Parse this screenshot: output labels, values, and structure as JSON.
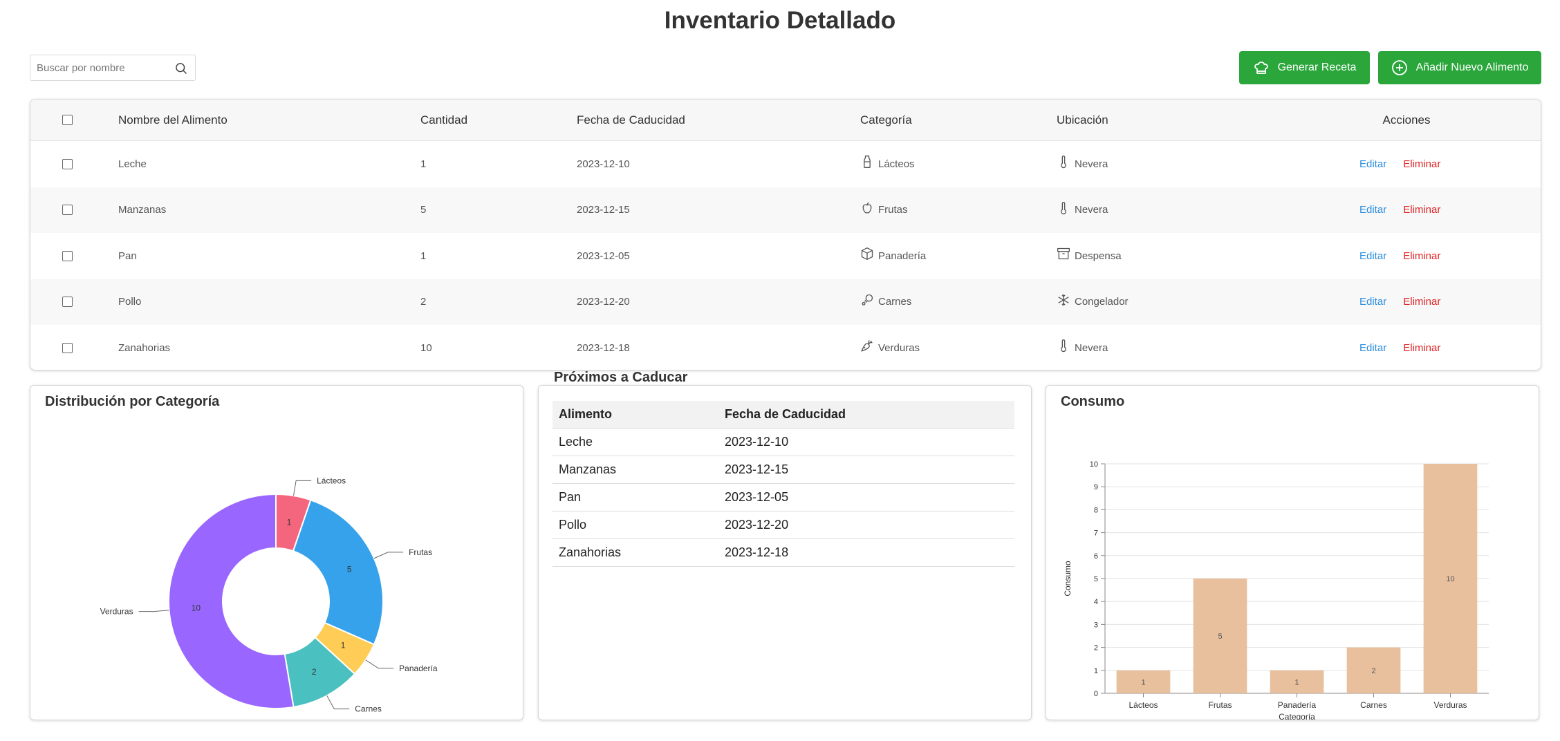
{
  "page": {
    "title": "Inventario Detallado"
  },
  "search": {
    "placeholder": "Buscar por nombre",
    "icon": "search-icon"
  },
  "toolbar": {
    "recipe_label": "Generar Receta",
    "recipe_icon": "chef-hat-icon",
    "add_label": "Añadir Nuevo Alimento",
    "add_icon": "plus-circle-icon"
  },
  "accent_color": "#2aa63b",
  "table": {
    "headers": {
      "name": "Nombre del Alimento",
      "qty": "Cantidad",
      "date": "Fecha de Caducidad",
      "category": "Categoría",
      "location": "Ubicación",
      "actions": "Acciones"
    },
    "rows": [
      {
        "name": "Leche",
        "qty": "1",
        "date": "2023-12-10",
        "category": "Lácteos",
        "category_icon": "milk-bottle-icon",
        "location": "Nevera",
        "location_icon": "thermometer-icon",
        "edit": "Editar",
        "delete": "Eliminar"
      },
      {
        "name": "Manzanas",
        "qty": "5",
        "date": "2023-12-15",
        "category": "Frutas",
        "category_icon": "apple-icon",
        "location": "Nevera",
        "location_icon": "thermometer-icon",
        "edit": "Editar",
        "delete": "Eliminar"
      },
      {
        "name": "Pan",
        "qty": "1",
        "date": "2023-12-05",
        "category": "Panadería",
        "category_icon": "box-icon",
        "location": "Despensa",
        "location_icon": "archive-icon",
        "edit": "Editar",
        "delete": "Eliminar"
      },
      {
        "name": "Pollo",
        "qty": "2",
        "date": "2023-12-20",
        "category": "Carnes",
        "category_icon": "drumstick-icon",
        "location": "Congelador",
        "location_icon": "snowflake-icon",
        "edit": "Editar",
        "delete": "Eliminar"
      },
      {
        "name": "Zanahorias",
        "qty": "10",
        "date": "2023-12-18",
        "category": "Verduras",
        "category_icon": "carrot-icon",
        "location": "Nevera",
        "location_icon": "thermometer-icon",
        "edit": "Editar",
        "delete": "Eliminar"
      }
    ],
    "edit_color": "#2b8ee0",
    "delete_color": "#e02424"
  },
  "category_panel": {
    "title": "Distribución por Categoría"
  },
  "expiring_panel": {
    "title": "Próximos a Caducar",
    "headers": {
      "food": "Alimento",
      "date": "Fecha de Caducidad"
    },
    "rows": [
      {
        "food": "Leche",
        "date": "2023-12-10"
      },
      {
        "food": "Manzanas",
        "date": "2023-12-15"
      },
      {
        "food": "Pan",
        "date": "2023-12-05"
      },
      {
        "food": "Pollo",
        "date": "2023-12-20"
      },
      {
        "food": "Zanahorias",
        "date": "2023-12-18"
      }
    ]
  },
  "consumption_panel": {
    "title": "Consumo"
  },
  "chart_data": [
    {
      "type": "pie",
      "title": "Distribución por Categoría",
      "donut": true,
      "categories": [
        "Lácteos",
        "Frutas",
        "Panadería",
        "Carnes",
        "Verduras"
      ],
      "values": [
        1,
        5,
        1,
        2,
        10
      ],
      "colors": [
        "#f4657e",
        "#36a2eb",
        "#ffcd56",
        "#4bc0c0",
        "#9966ff"
      ]
    },
    {
      "type": "bar",
      "title": "Consumo",
      "categories": [
        "Lácteos",
        "Frutas",
        "Panadería",
        "Carnes",
        "Verduras"
      ],
      "values": [
        1,
        5,
        1,
        2,
        10
      ],
      "xlabel": "Categoría",
      "ylabel": "Consumo",
      "ylim": [
        0,
        10
      ],
      "yticks": [
        0,
        1,
        2,
        3,
        4,
        5,
        6,
        7,
        8,
        9,
        10
      ],
      "grid": true,
      "bar_color": "#e8c09e"
    }
  ]
}
